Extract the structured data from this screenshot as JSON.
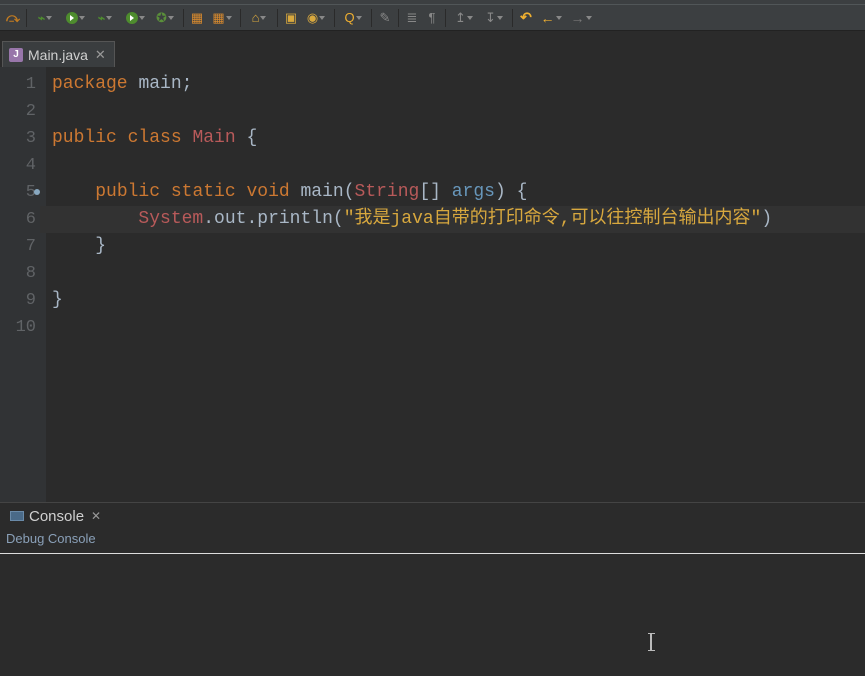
{
  "tab": {
    "filename": "Main.java",
    "icon_letter": "J"
  },
  "code": {
    "lines": [
      {
        "n": 1,
        "segments": [
          {
            "t": "package",
            "c": "kw"
          },
          {
            "t": " ",
            "c": "punc"
          },
          {
            "t": "main",
            "c": "fn"
          },
          {
            "t": ";",
            "c": "punc"
          }
        ]
      },
      {
        "n": 2,
        "segments": []
      },
      {
        "n": 3,
        "segments": [
          {
            "t": "public",
            "c": "kw"
          },
          {
            "t": " ",
            "c": "punc"
          },
          {
            "t": "class",
            "c": "kw"
          },
          {
            "t": " ",
            "c": "punc"
          },
          {
            "t": "Main",
            "c": "cls"
          },
          {
            "t": " {",
            "c": "punc"
          }
        ]
      },
      {
        "n": 4,
        "segments": []
      },
      {
        "n": 5,
        "mark": true,
        "segments": [
          {
            "t": "    ",
            "c": "punc"
          },
          {
            "t": "public",
            "c": "kw"
          },
          {
            "t": " ",
            "c": "punc"
          },
          {
            "t": "static",
            "c": "kw"
          },
          {
            "t": " ",
            "c": "punc"
          },
          {
            "t": "void",
            "c": "kw"
          },
          {
            "t": " ",
            "c": "punc"
          },
          {
            "t": "main",
            "c": "fn"
          },
          {
            "t": "(",
            "c": "punc"
          },
          {
            "t": "String",
            "c": "param-type"
          },
          {
            "t": "[] ",
            "c": "punc"
          },
          {
            "t": "args",
            "c": "param"
          },
          {
            "t": ") {",
            "c": "punc"
          }
        ]
      },
      {
        "n": 6,
        "hl": true,
        "segments": [
          {
            "t": "        ",
            "c": "punc"
          },
          {
            "t": "System",
            "c": "cls"
          },
          {
            "t": ".",
            "c": "dot"
          },
          {
            "t": "out",
            "c": "fn"
          },
          {
            "t": ".",
            "c": "dot"
          },
          {
            "t": "println",
            "c": "fn"
          },
          {
            "t": "(",
            "c": "punc"
          },
          {
            "t": "\"我是java自带的打印命令,可以往控制台输出内容\"",
            "c": "str"
          },
          {
            "t": ")",
            "c": "punc"
          }
        ]
      },
      {
        "n": 7,
        "segments": [
          {
            "t": "    }",
            "c": "punc"
          }
        ]
      },
      {
        "n": 8,
        "segments": []
      },
      {
        "n": 9,
        "segments": [
          {
            "t": "}",
            "c": "punc"
          }
        ]
      },
      {
        "n": 10,
        "segments": []
      }
    ]
  },
  "console": {
    "tab_label": "Console",
    "sub_label": "Debug Console"
  },
  "toolbar_icons": [
    {
      "name": "skip-breakpoints-icon",
      "glyph": "⤼",
      "cls": "skip"
    },
    {
      "sep": true
    },
    {
      "name": "debug-icon",
      "glyph": "⌁",
      "cls": "bug",
      "dd": true
    },
    {
      "name": "run-icon",
      "circ": true,
      "dd": true
    },
    {
      "name": "debug2-icon",
      "glyph": "⌁",
      "cls": "bug",
      "dd": true
    },
    {
      "name": "coverage-icon",
      "circ": true,
      "dd": true
    },
    {
      "name": "profile-icon",
      "glyph": "✪",
      "cls": "prof",
      "dd": true
    },
    {
      "sep": true
    },
    {
      "name": "build-icon",
      "glyph": "▦",
      "cls": "pal"
    },
    {
      "name": "build2-icon",
      "glyph": "▦",
      "cls": "pal",
      "dd": true
    },
    {
      "sep": true
    },
    {
      "name": "open-type-icon",
      "glyph": "⌂",
      "cls": "folder",
      "dd": true
    },
    {
      "sep": true
    },
    {
      "name": "new-package-icon",
      "glyph": "▣",
      "cls": "folder"
    },
    {
      "name": "new-class-icon",
      "glyph": "◉",
      "cls": "folder",
      "dd": true
    },
    {
      "sep": true
    },
    {
      "name": "search-icon",
      "glyph": "Q",
      "cls": "mag",
      "dd": true
    },
    {
      "sep": true
    },
    {
      "name": "pencil-icon",
      "glyph": "✎",
      "cls": "pen"
    },
    {
      "sep": true
    },
    {
      "name": "toggle1-icon",
      "glyph": "≣",
      "cls": "para"
    },
    {
      "name": "pilcrow-icon",
      "glyph": "¶",
      "cls": "para"
    },
    {
      "sep": true
    },
    {
      "name": "export-icon",
      "glyph": "↥",
      "cls": "para",
      "dd": true
    },
    {
      "name": "import-icon",
      "glyph": "↧",
      "cls": "para",
      "dd": true
    },
    {
      "sep": true
    },
    {
      "name": "last-edit-icon",
      "glyph": "↶",
      "cls": "arrow-left"
    },
    {
      "name": "back-icon",
      "glyph": "←",
      "cls": "arrow-left",
      "dd": true
    },
    {
      "name": "forward-icon",
      "glyph": "→",
      "cls": "arrow-right",
      "dd": true
    }
  ]
}
